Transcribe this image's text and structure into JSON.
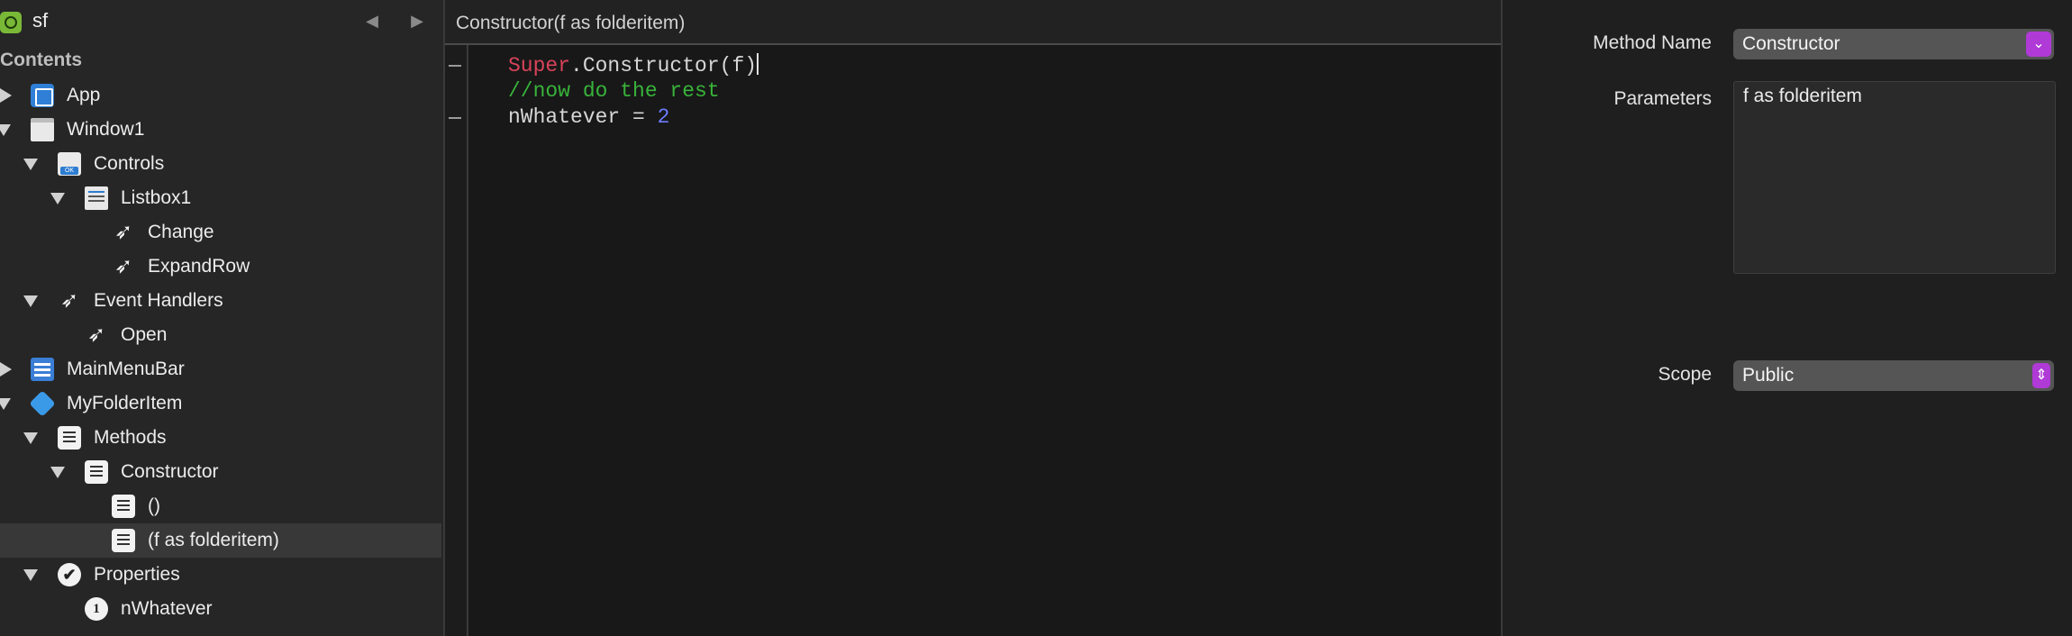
{
  "navigator": {
    "project_name": "sf",
    "back_glyph": "◀",
    "forward_glyph": "▶",
    "contents_label": "Contents",
    "rows": [
      {
        "label": "App"
      },
      {
        "label": "Window1"
      },
      {
        "label": "Controls"
      },
      {
        "label": "Listbox1"
      },
      {
        "label": "Change"
      },
      {
        "label": "ExpandRow"
      },
      {
        "label": "Event Handlers"
      },
      {
        "label": "Open"
      },
      {
        "label": "MainMenuBar"
      },
      {
        "label": "MyFolderItem"
      },
      {
        "label": "Methods"
      },
      {
        "label": "Constructor"
      },
      {
        "label": "()"
      },
      {
        "label": "(f as folderitem)"
      },
      {
        "label": "Properties"
      },
      {
        "label": "nWhatever"
      }
    ],
    "property_number_glyph": "1",
    "check_glyph": "✔"
  },
  "editor": {
    "title": "Constructor(f as folderitem)",
    "lines": {
      "l1_super": "Super",
      "l1_rest": ".Constructor(f)",
      "l2_comment": "//now do the rest",
      "l3_ident": "nWhatever = ",
      "l3_num": "2"
    }
  },
  "inspector": {
    "method_name_label": "Method Name",
    "method_name_value": "Constructor",
    "parameters_label": "Parameters",
    "parameters_value": "f as folderitem",
    "scope_label": "Scope",
    "scope_value": "Public",
    "combo_chevron": "⌄",
    "popup_chevron": "⇕"
  },
  "colors": {
    "accent": "#b03ad6",
    "keyword_super": "#d9435a",
    "comment": "#38b33a",
    "number": "#6b7cff"
  }
}
